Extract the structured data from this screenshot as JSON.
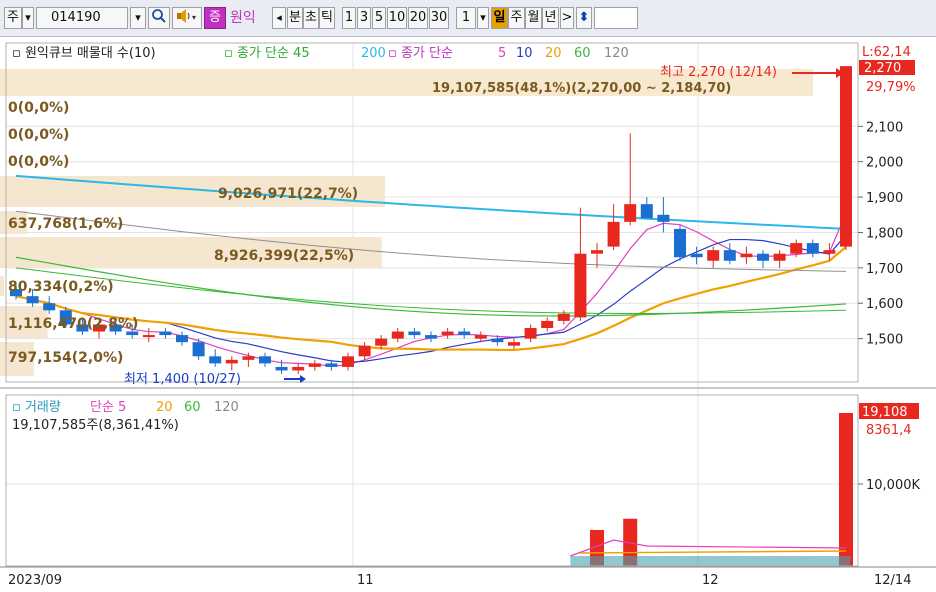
{
  "toolbar": {
    "market": "주",
    "code": "014190",
    "stock_tag": "증",
    "stock_name": "원익",
    "tabs": [
      "분",
      "초",
      "틱"
    ],
    "intervals": [
      "1",
      "3",
      "5",
      "10",
      "20",
      "30"
    ],
    "period_value": "1",
    "period_tabs": [
      "일",
      "주",
      "월",
      "년"
    ],
    "next": ">",
    "icons": [
      "dropdown-icon",
      "search-icon",
      "speaker-icon",
      "left-arrow-icon",
      "up-down-arrow-icon"
    ]
  },
  "legend_price": {
    "title": "원익큐브 매물대 수(10)",
    "close_label": "종가 단순",
    "close_a": "45",
    "close_b": "200",
    "close2_label": "종가 단순",
    "ma": [
      "5",
      "10",
      "20",
      "60",
      "120"
    ]
  },
  "legend_volume": {
    "title": "거래량",
    "ma_label": "단순",
    "ma": [
      "5",
      "20",
      "60",
      "120"
    ],
    "current": "19,107,585주(8,361,41%)"
  },
  "annotations": {
    "high": "최고 2,270 (12/14)",
    "low": "최저 1,400 (10/27)",
    "top_box": "19,107,585(48,1%)(2,270,00 ~ 2,184,70)"
  },
  "volume_profile": [
    "0(0,0%)",
    "0(0,0%)",
    "0(0,0%)",
    "9,026,971(22,7%)",
    "637,768(1,6%)",
    "8,926,399(22,5%)",
    "80,334(0,2%)",
    "1,116,470(2,8%)",
    "797,154(2,0%)"
  ],
  "price_axis": {
    "ticks": [
      "2,100",
      "2,000",
      "1,900",
      "1,800",
      "1,700",
      "1,600",
      "1,500"
    ],
    "top_partial": "L:62,14",
    "current_price": "2,270",
    "current_pct": "29,79%"
  },
  "volume_axis": {
    "current": "19,108",
    "pct": "8361,4",
    "tick": "10,000K"
  },
  "date_axis": {
    "labels": [
      "2023/09",
      "11",
      "12"
    ],
    "last_date": "12/14"
  },
  "colors": {
    "up": "#e8281e",
    "down": "#1a6fd0",
    "ma5": "#e040c0",
    "ma10": "#2a3cc8",
    "ma20": "#f0a000",
    "ma60": "#3ab83a",
    "ma120": "#909090",
    "ma200": "#2ab8e8"
  },
  "chart_data": {
    "type": "candlestick",
    "x": [
      "10/04",
      "10/05",
      "10/06",
      "10/10",
      "10/11",
      "10/12",
      "10/13",
      "10/16",
      "10/17",
      "10/18",
      "10/19",
      "10/20",
      "10/23",
      "10/24",
      "10/25",
      "10/26",
      "10/27",
      "10/30",
      "10/31",
      "11/01",
      "11/02",
      "11/03",
      "11/06",
      "11/07",
      "11/08",
      "11/09",
      "11/10",
      "11/13",
      "11/14",
      "11/15",
      "11/16",
      "11/17",
      "11/20",
      "11/21",
      "11/22",
      "11/23",
      "11/24",
      "11/27",
      "11/28",
      "11/29",
      "11/30",
      "12/01",
      "12/04",
      "12/05",
      "12/06",
      "12/07",
      "12/08",
      "12/11",
      "12/12",
      "12/13",
      "12/14"
    ],
    "ohlc": [
      [
        1640,
        1660,
        1610,
        1620
      ],
      [
        1620,
        1640,
        1590,
        1600
      ],
      [
        1600,
        1620,
        1570,
        1580
      ],
      [
        1580,
        1590,
        1530,
        1540
      ],
      [
        1540,
        1560,
        1510,
        1520
      ],
      [
        1520,
        1550,
        1500,
        1540
      ],
      [
        1540,
        1560,
        1510,
        1520
      ],
      [
        1520,
        1540,
        1500,
        1510
      ],
      [
        1510,
        1530,
        1490,
        1510
      ],
      [
        1520,
        1530,
        1500,
        1510
      ],
      [
        1510,
        1520,
        1480,
        1490
      ],
      [
        1490,
        1500,
        1440,
        1450
      ],
      [
        1450,
        1470,
        1420,
        1430
      ],
      [
        1430,
        1450,
        1410,
        1440
      ],
      [
        1440,
        1460,
        1420,
        1450
      ],
      [
        1450,
        1460,
        1420,
        1430
      ],
      [
        1420,
        1440,
        1400,
        1410
      ],
      [
        1410,
        1430,
        1400,
        1420
      ],
      [
        1420,
        1440,
        1410,
        1430
      ],
      [
        1430,
        1440,
        1410,
        1420
      ],
      [
        1420,
        1460,
        1410,
        1450
      ],
      [
        1450,
        1490,
        1440,
        1480
      ],
      [
        1480,
        1510,
        1470,
        1500
      ],
      [
        1500,
        1530,
        1490,
        1520
      ],
      [
        1520,
        1530,
        1500,
        1510
      ],
      [
        1510,
        1520,
        1490,
        1500
      ],
      [
        1510,
        1530,
        1500,
        1520
      ],
      [
        1520,
        1530,
        1500,
        1510
      ],
      [
        1500,
        1520,
        1490,
        1510
      ],
      [
        1500,
        1510,
        1480,
        1490
      ],
      [
        1480,
        1500,
        1470,
        1490
      ],
      [
        1500,
        1540,
        1490,
        1530
      ],
      [
        1530,
        1560,
        1520,
        1550
      ],
      [
        1550,
        1580,
        1540,
        1570
      ],
      [
        1560,
        1870,
        1550,
        1740
      ],
      [
        1740,
        1770,
        1700,
        1750
      ],
      [
        1760,
        1880,
        1750,
        1830
      ],
      [
        1830,
        2080,
        1820,
        1880
      ],
      [
        1880,
        1900,
        1840,
        1840
      ],
      [
        1850,
        1900,
        1800,
        1830
      ],
      [
        1810,
        1820,
        1720,
        1730
      ],
      [
        1740,
        1760,
        1710,
        1730
      ],
      [
        1720,
        1760,
        1700,
        1750
      ],
      [
        1750,
        1770,
        1710,
        1720
      ],
      [
        1730,
        1760,
        1710,
        1740
      ],
      [
        1740,
        1750,
        1700,
        1720
      ],
      [
        1720,
        1750,
        1700,
        1740
      ],
      [
        1740,
        1780,
        1730,
        1770
      ],
      [
        1770,
        1780,
        1730,
        1740
      ],
      [
        1740,
        1770,
        1720,
        1750
      ],
      [
        1760,
        2270,
        1750,
        2270
      ]
    ],
    "volume_tail": {
      "x": [
        "11/23",
        "11/27",
        "12/14"
      ],
      "values": [
        4500000,
        5900000,
        19107585
      ]
    },
    "ylim": [
      1380,
      2280
    ],
    "ylabel": "",
    "series": [
      {
        "name": "5",
        "type": "ma"
      },
      {
        "name": "10",
        "type": "ma"
      },
      {
        "name": "20",
        "type": "ma"
      },
      {
        "name": "60",
        "type": "ma"
      },
      {
        "name": "120",
        "type": "ma"
      },
      {
        "name": "200",
        "type": "ma"
      }
    ]
  }
}
